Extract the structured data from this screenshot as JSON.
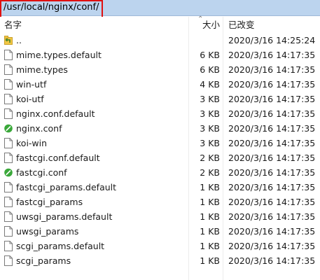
{
  "path_bar": {
    "path": "/usr/local/nginx/conf/"
  },
  "columns": {
    "name": "名字",
    "size": "大小",
    "modified": "已改变"
  },
  "files": [
    {
      "name": "..",
      "size": "",
      "modified": "2020/3/16 14:25:24",
      "icon": "parent-folder-icon"
    },
    {
      "name": "mime.types.default",
      "size": "6 KB",
      "modified": "2020/3/16 14:17:35",
      "icon": "file-icon"
    },
    {
      "name": "mime.types",
      "size": "6 KB",
      "modified": "2020/3/16 14:17:35",
      "icon": "file-icon"
    },
    {
      "name": "win-utf",
      "size": "4 KB",
      "modified": "2020/3/16 14:17:35",
      "icon": "file-icon"
    },
    {
      "name": "koi-utf",
      "size": "3 KB",
      "modified": "2020/3/16 14:17:35",
      "icon": "file-icon"
    },
    {
      "name": "nginx.conf.default",
      "size": "3 KB",
      "modified": "2020/3/16 14:17:35",
      "icon": "file-icon"
    },
    {
      "name": "nginx.conf",
      "size": "3 KB",
      "modified": "2020/3/16 14:17:35",
      "icon": "conf-file-icon"
    },
    {
      "name": "koi-win",
      "size": "3 KB",
      "modified": "2020/3/16 14:17:35",
      "icon": "file-icon"
    },
    {
      "name": "fastcgi.conf.default",
      "size": "2 KB",
      "modified": "2020/3/16 14:17:35",
      "icon": "file-icon"
    },
    {
      "name": "fastcgi.conf",
      "size": "2 KB",
      "modified": "2020/3/16 14:17:35",
      "icon": "conf-file-icon"
    },
    {
      "name": "fastcgi_params.default",
      "size": "1 KB",
      "modified": "2020/3/16 14:17:35",
      "icon": "file-icon"
    },
    {
      "name": "fastcgi_params",
      "size": "1 KB",
      "modified": "2020/3/16 14:17:35",
      "icon": "file-icon"
    },
    {
      "name": "uwsgi_params.default",
      "size": "1 KB",
      "modified": "2020/3/16 14:17:35",
      "icon": "file-icon"
    },
    {
      "name": "uwsgi_params",
      "size": "1 KB",
      "modified": "2020/3/16 14:17:35",
      "icon": "file-icon"
    },
    {
      "name": "scgi_params.default",
      "size": "1 KB",
      "modified": "2020/3/16 14:17:35",
      "icon": "file-icon"
    },
    {
      "name": "scgi_params",
      "size": "1 KB",
      "modified": "2020/3/16 14:17:35",
      "icon": "file-icon"
    }
  ],
  "colors": {
    "path_bar_bg": "#bcd4ee",
    "highlight": "#e01010",
    "conf_icon": "#3aa83a",
    "folder_icon": "#f2c744"
  }
}
